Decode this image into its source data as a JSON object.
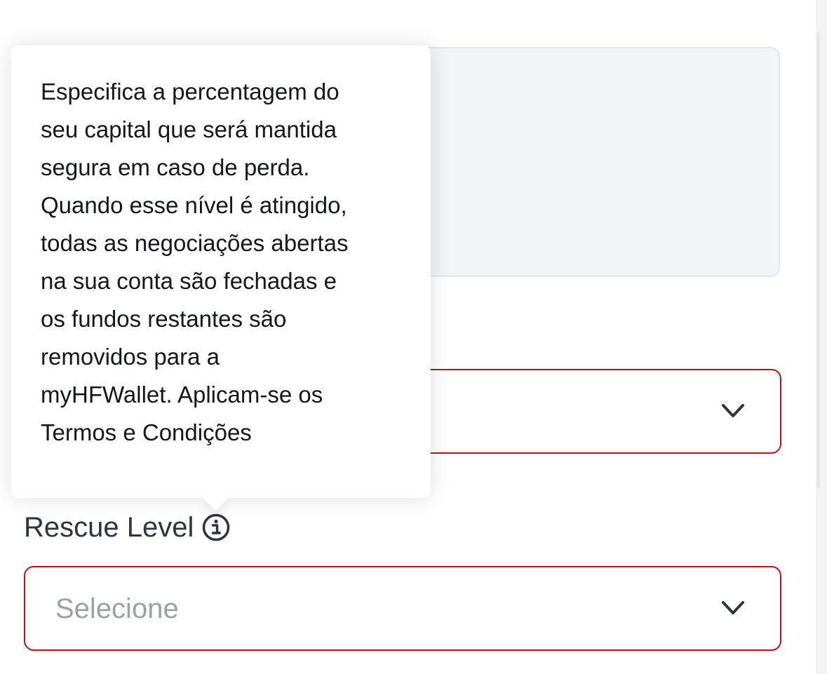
{
  "tooltip": {
    "text": "Especifica a percentagem do\nseu capital que será mantida\nsegura em caso de perda.\nQuando esse nível é atingido,\ntodas as negociações abertas\nna sua conta são fechadas e\nos fundos restantes são\nremovidos para a\nmyHFWallet. Aplicam-se os\nTermos e Condições"
  },
  "fields": {
    "upper_select": {
      "value": ""
    },
    "rescue_level": {
      "label": "Rescue Level",
      "placeholder": "Selecione"
    }
  },
  "icons": {
    "info": "info-icon",
    "chevron": "chevron-down-icon"
  },
  "colors": {
    "error_border": "#b3141c",
    "label_text": "#2f3342",
    "placeholder_text": "#9ea0a8",
    "textarea_bg": "#f3f4f8"
  }
}
